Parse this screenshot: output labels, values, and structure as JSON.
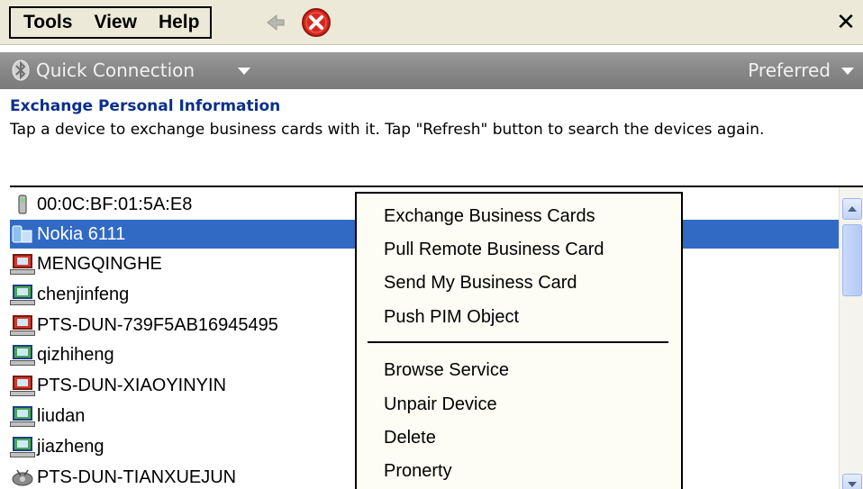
{
  "menubar": {
    "menus": [
      "Tools",
      "View",
      "Help"
    ],
    "back_icon": "back-arrow-icon",
    "stop_icon": "stop-icon",
    "close_label": "✕"
  },
  "connbar": {
    "quick_connection_label": "Quick Connection",
    "preferred_label": "Preferred",
    "bluetooth_icon": "bluetooth-icon"
  },
  "page": {
    "heading": "Exchange Personal Information",
    "description": "Tap a device to exchange business cards with it. Tap \"Refresh\" button to search the devices again."
  },
  "devices": [
    {
      "name": "00:0C:BF:01:5A:E8",
      "icon": "phone-device-icon",
      "selected": false
    },
    {
      "name": "Nokia 6111",
      "icon": "mobile-device-icon",
      "selected": true
    },
    {
      "name": "MENGQINGHE",
      "icon": "computer-red-icon",
      "selected": false
    },
    {
      "name": "chenjinfeng",
      "icon": "computer-icon",
      "selected": false
    },
    {
      "name": "PTS-DUN-739F5AB16945495",
      "icon": "computer-red-icon",
      "selected": false
    },
    {
      "name": "qizhiheng",
      "icon": "computer-icon",
      "selected": false
    },
    {
      "name": "PTS-DUN-XIAOYINYIN",
      "icon": "computer-red-icon",
      "selected": false
    },
    {
      "name": "liudan",
      "icon": "computer-icon",
      "selected": false
    },
    {
      "name": "jiazheng",
      "icon": "computer-icon",
      "selected": false
    },
    {
      "name": "PTS-DUN-TIANXUEJUN",
      "icon": "network-device-icon",
      "selected": false
    }
  ],
  "context_menu": {
    "group1": [
      "Exchange Business Cards",
      "Pull Remote Business Card",
      "Send My Business Card",
      "Push PIM Object"
    ],
    "group2": [
      "Browse Service",
      "Unpair Device",
      "Delete",
      "Pronerty"
    ]
  },
  "colors": {
    "selection": "#316ac5",
    "heading": "#0b2f8a",
    "menubar_bg": "#ece9d8"
  }
}
